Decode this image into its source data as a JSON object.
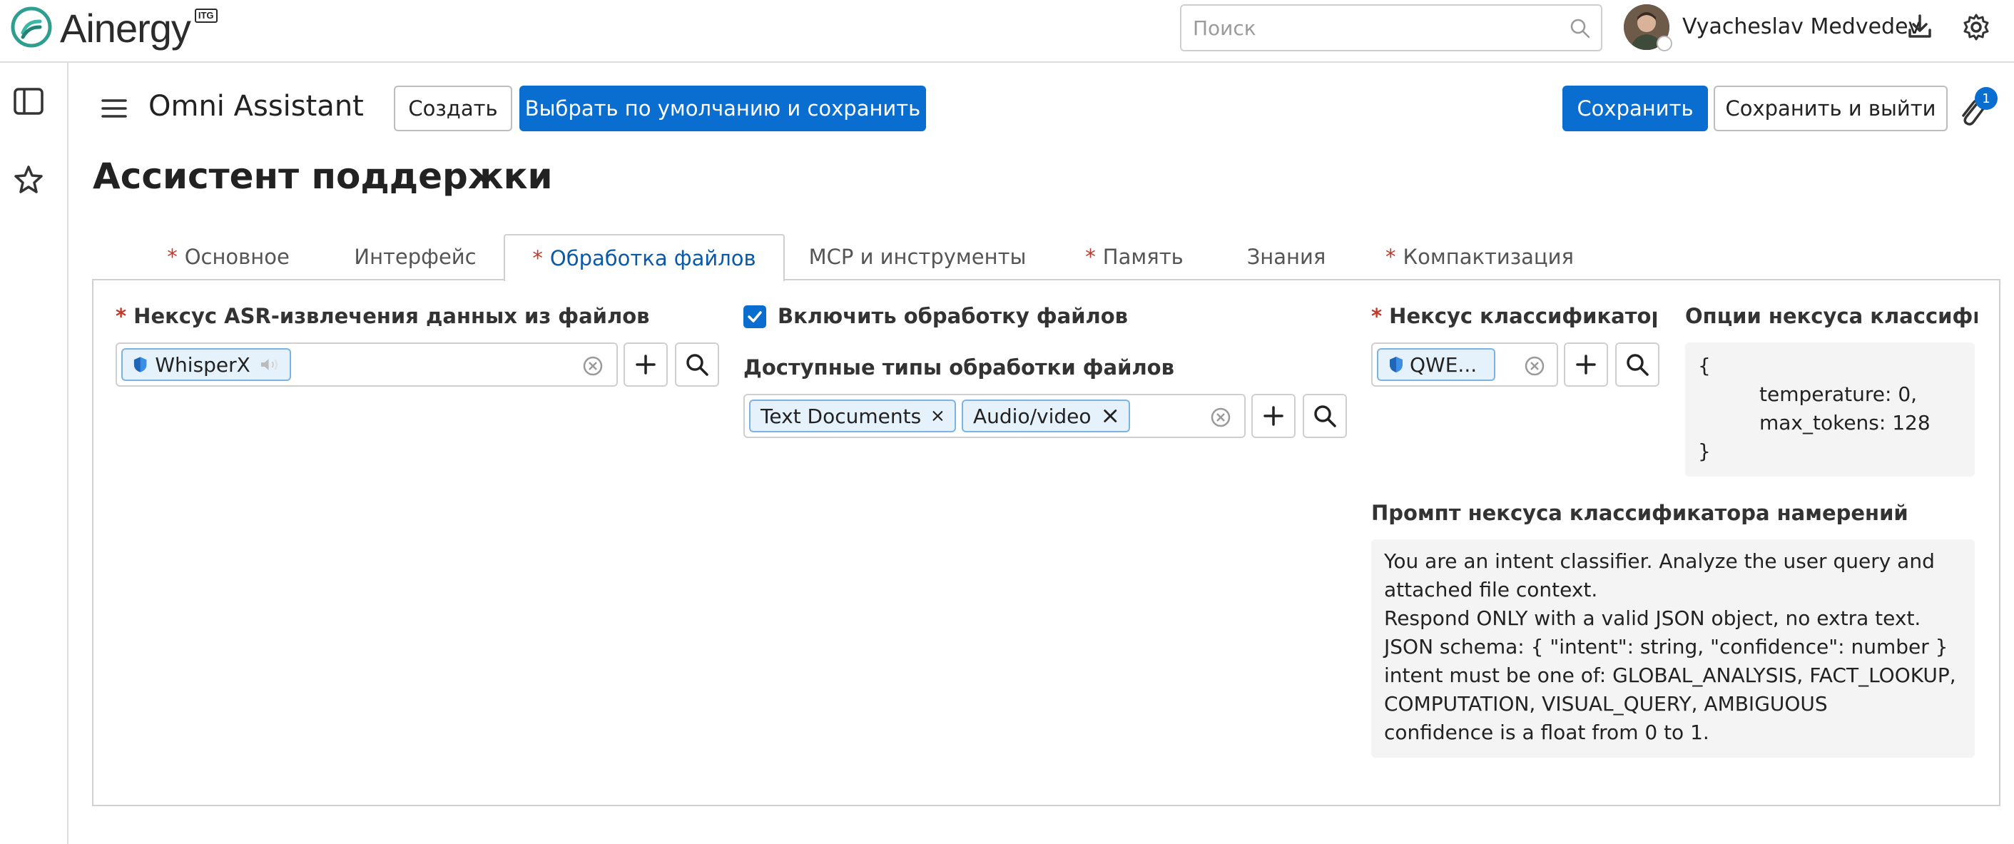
{
  "topbar": {
    "brand": "Ainergy",
    "brand_badge": "ITG",
    "search_placeholder": "Поиск",
    "user_name": "Vyacheslav Medvedev",
    "icons": [
      "search-icon",
      "download-icon",
      "gear-icon"
    ]
  },
  "sidebar": {
    "icons": [
      "panel-toggle-icon",
      "star-icon"
    ]
  },
  "header": {
    "app_title": "Omni Assistant",
    "create_label": "Создать",
    "default_save_label": "Выбрать по умолчанию и сохранить",
    "save_label": "Сохранить",
    "save_exit_label": "Сохранить и выйти",
    "attachments_count": "1"
  },
  "page": {
    "title": "Ассистент поддержки"
  },
  "tabs": [
    {
      "label": "Основное",
      "required": "*"
    },
    {
      "label": "Интерфейс",
      "required": ""
    },
    {
      "label": "Обработка файлов",
      "required": "*"
    },
    {
      "label": "MCP и инструменты",
      "required": ""
    },
    {
      "label": "Память",
      "required": "*"
    },
    {
      "label": "Знания",
      "required": ""
    },
    {
      "label": "Компактизация",
      "required": "*"
    }
  ],
  "active_tab": "Обработка файлов",
  "form": {
    "asr": {
      "label": "Нексус ASR-извлечения данных из файлов",
      "required": "*",
      "value": "WhisperX"
    },
    "enable_processing": {
      "label": "Включить обработку файлов",
      "checked": true
    },
    "file_types": {
      "label": "Доступные типы обработки файлов",
      "values": [
        "Text Documents",
        "Audio/video"
      ]
    },
    "classifier": {
      "label": "Нексус классификатора ...",
      "required": "*",
      "value": "QWE..."
    },
    "classifier_options": {
      "label": "Опции нексуса классифик...",
      "lines": [
        "{",
        "temperature: 0,",
        "max_tokens: 128",
        "}"
      ]
    },
    "prompt": {
      "label": "Промпт нексуса классификатора намерений",
      "lines": [
        "You are an intent classifier. Analyze the user query and",
        "attached file context.",
        "Respond ONLY with a valid JSON object, no extra text.",
        "JSON schema: { \"intent\": string, \"confidence\": number }",
        "intent must be one of: GLOBAL_ANALYSIS, FACT_LOOKUP,",
        "COMPUTATION, VISUAL_QUERY, AMBIGUOUS",
        "confidence is a float from 0 to 1."
      ]
    }
  },
  "colors": {
    "primary": "#0a6ed1",
    "required": "#c0392b",
    "tag_bg": "#e6f2fb",
    "tag_border": "#7bb4e3",
    "brand": "#2f9e8f"
  }
}
